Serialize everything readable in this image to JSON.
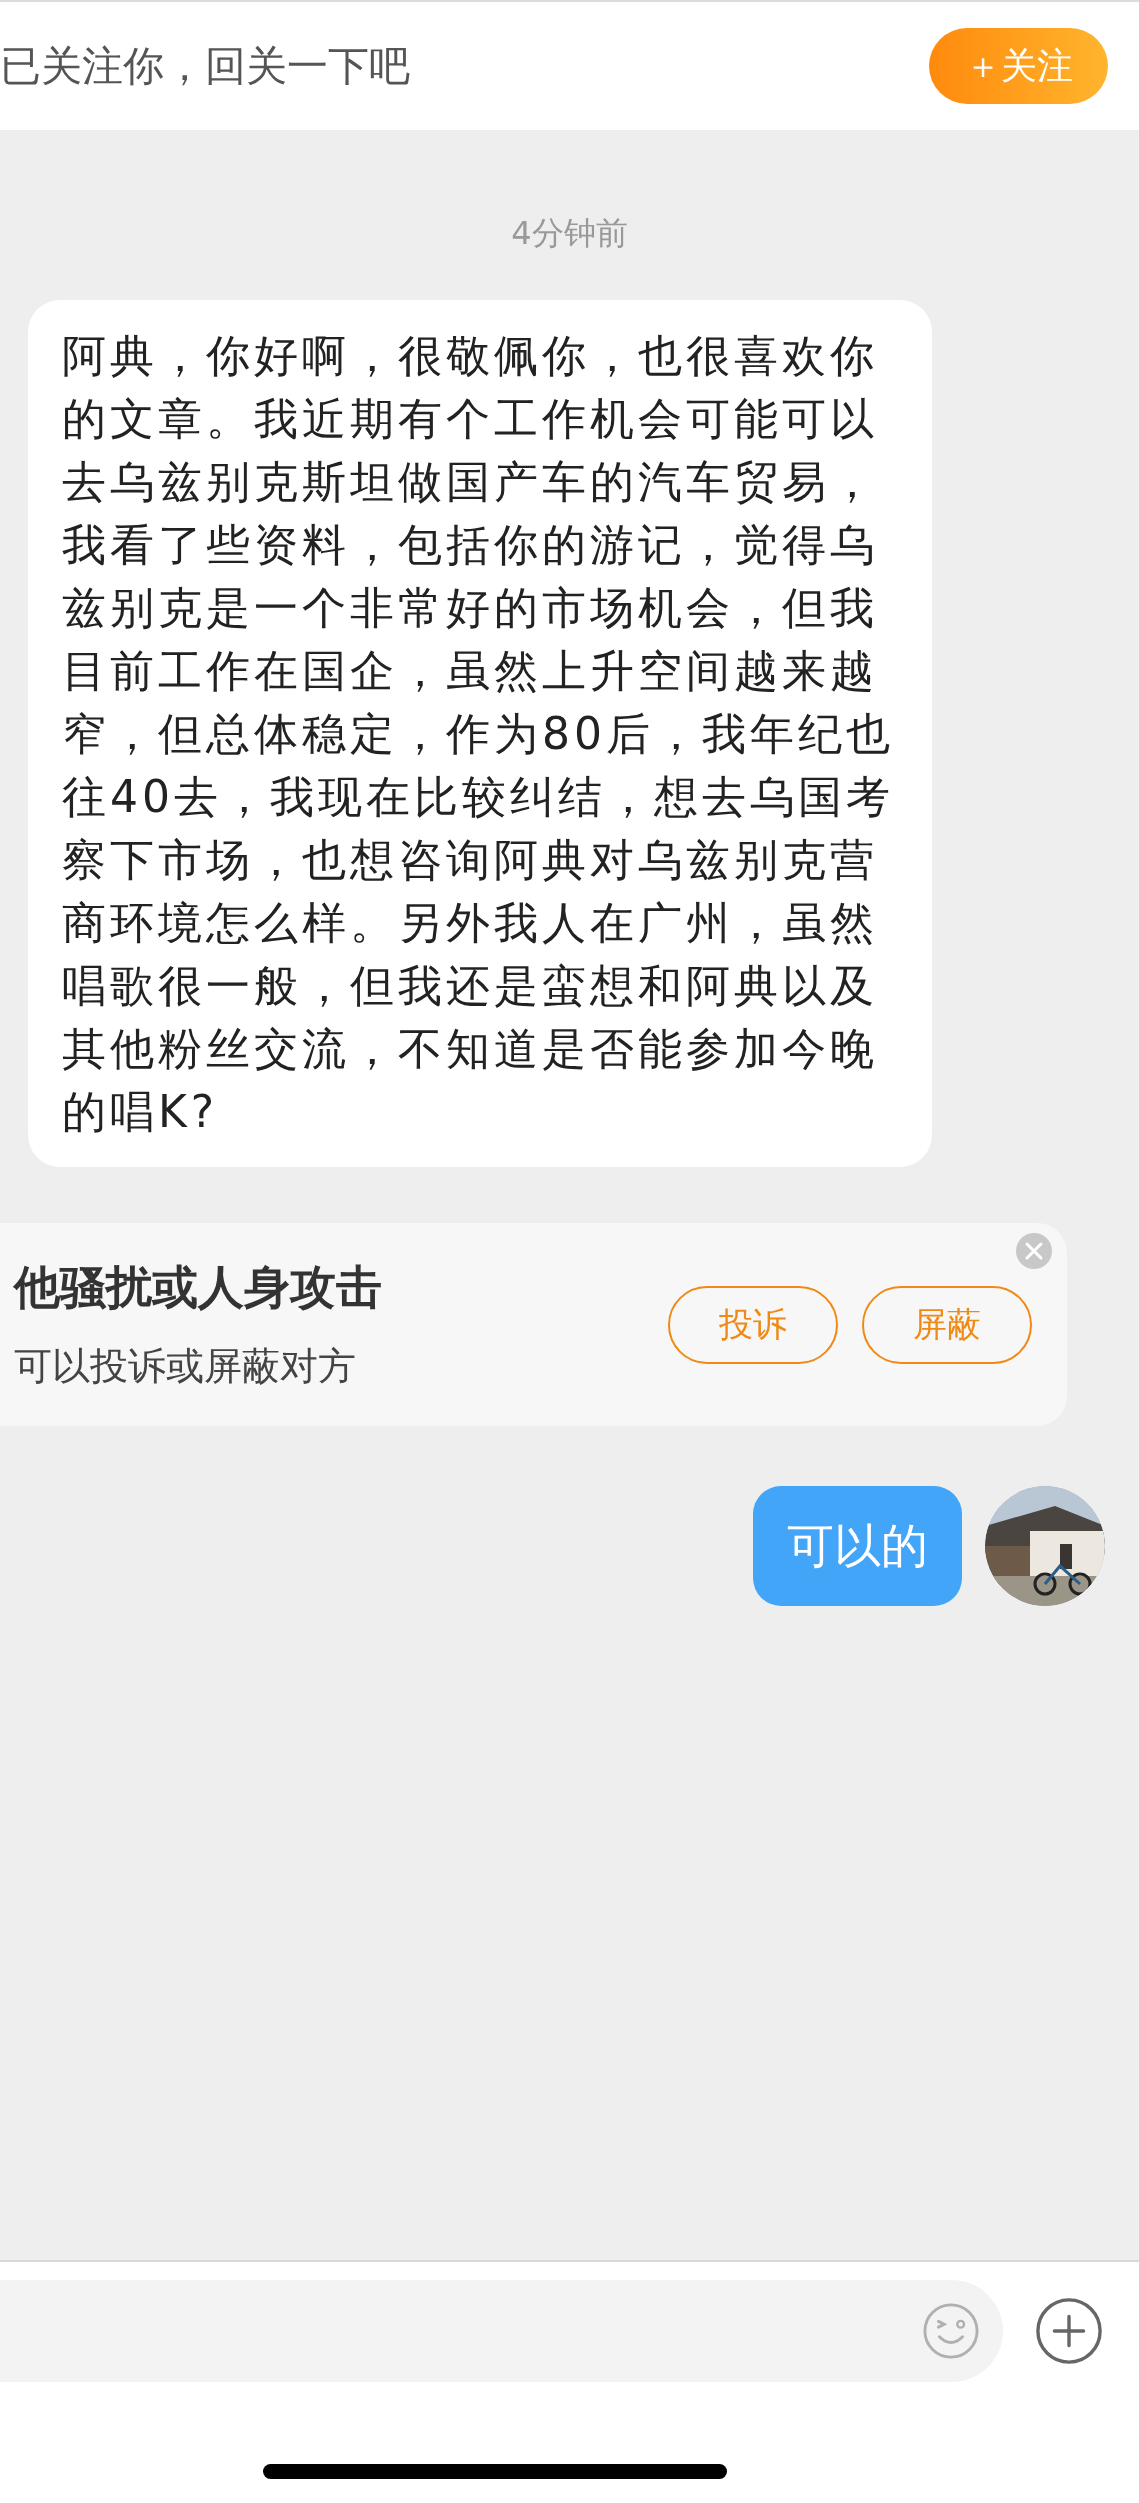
{
  "header": {
    "notice": "已关注你，回关一下吧",
    "follow_button": "＋关注"
  },
  "timestamp": "4分钟前",
  "messages": [
    {
      "kind": "received",
      "text": "阿典，你好啊，很敬佩你，也很喜欢你的文章。我近期有个工作机会可能可以去乌兹别克斯坦做国产车的汽车贸易，我看了些资料，包括你的游记，觉得乌兹别克是一个非常好的市场机会，但我目前工作在国企，虽然上升空间越来越窄，但总体稳定，作为80后，我年纪也往40去，我现在比较纠结，想去乌国考察下市场，也想咨询阿典对乌兹别克营商环境怎么样。另外我人在广州，虽然唱歌很一般，但我还是蛮想和阿典以及其他粉丝交流，不知道是否能参加今晚的唱K?"
    }
  ],
  "safety_card": {
    "title": "他骚扰或人身攻击",
    "subtitle": "可以投诉或屏蔽对方",
    "buttons": [
      "投诉",
      "屏蔽"
    ]
  },
  "replies": [
    {
      "kind": "sent",
      "text": "可以的"
    }
  ]
}
